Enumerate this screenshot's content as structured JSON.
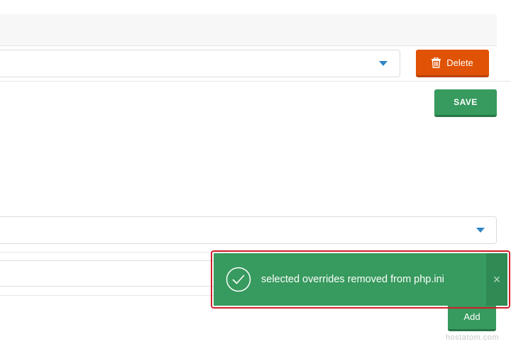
{
  "buttons": {
    "delete_label": "Delete",
    "save_label": "SAVE",
    "add_label": "Add"
  },
  "toast": {
    "message": "selected overrides removed from php.ini",
    "close_glyph": "×"
  },
  "watermark": "hostatom.com",
  "colors": {
    "delete": "#e05205",
    "success": "#379a5e",
    "caret": "#2f84c4",
    "highlight": "#d0202a"
  },
  "icons": {
    "delete": "trash-icon",
    "toast": "check-circle-icon",
    "dropdown": "caret-down-icon"
  }
}
